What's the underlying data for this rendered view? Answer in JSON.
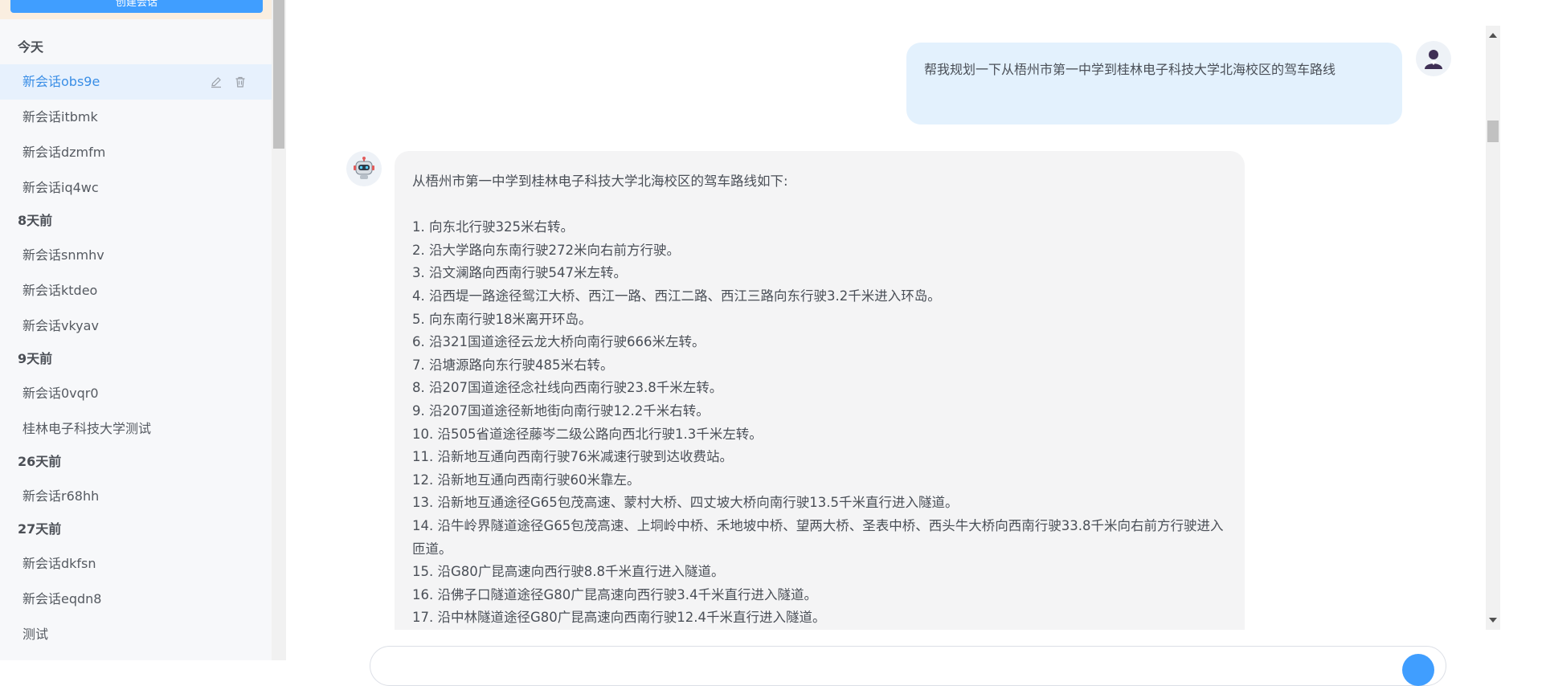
{
  "sidebar": {
    "new_chat_label": "创建会话",
    "groups": [
      {
        "label": "今天",
        "items": [
          "新会话obs9e",
          "新会话itbmk",
          "新会话dzmfm",
          "新会话iq4wc"
        ]
      },
      {
        "label": "8天前",
        "items": [
          "新会话snmhv",
          "新会话ktdeo",
          "新会话vkyav"
        ]
      },
      {
        "label": "9天前",
        "items": [
          "新会话0vqr0",
          "桂林电子科技大学测试"
        ]
      },
      {
        "label": "26天前",
        "items": [
          "新会话r68hh"
        ]
      },
      {
        "label": "27天前",
        "items": [
          "新会话dkfsn",
          "新会话eqdn8",
          "测试"
        ]
      }
    ],
    "active_item": "新会话obs9e"
  },
  "chat": {
    "user_message": "帮我规划一下从梧州市第一中学到桂林电子科技大学北海校区的驾车路线",
    "bot_intro": "从梧州市第一中学到桂林电子科技大学北海校区的驾车路线如下:",
    "steps": [
      "1. 向东北行驶325米右转。",
      "2. 沿大学路向东南行驶272米向右前方行驶。",
      "3. 沿文澜路向西南行驶547米左转。",
      "4. 沿西堤一路途径鸳江大桥、西江一路、西江二路、西江三路向东行驶3.2千米进入环岛。",
      "5. 向东南行驶18米离开环岛。",
      "6. 沿321国道途径云龙大桥向南行驶666米左转。",
      "7. 沿塘源路向东行驶485米右转。",
      "8. 沿207国道途径念社线向西南行驶23.8千米左转。",
      "9. 沿207国道途径新地街向南行驶12.2千米右转。",
      "10. 沿505省道途径藤岑二级公路向西北行驶1.3千米左转。",
      "11. 沿新地互通向西南行驶76米减速行驶到达收费站。",
      "12. 沿新地互通向西南行驶60米靠左。",
      "13. 沿新地互通途径G65包茂高速、蒙村大桥、四丈坡大桥向南行驶13.5千米直行进入隧道。",
      "14. 沿牛岭界隧道途径G65包茂高速、上垌岭中桥、禾地坡中桥、望两大桥、圣表中桥、西头牛大桥向西南行驶33.8千米向右前方行驶进入匝道。",
      "15. 沿G80广昆高速向西行驶8.8千米直行进入隧道。",
      "16. 沿佛子口隧道途径G80广昆高速向西行驶3.4千米直行进入隧道。",
      "17. 沿中林隧道途径G80广昆高速向西南行驶12.4千米直行进入隧道。"
    ]
  },
  "icons": {
    "edit": "edit-icon",
    "delete": "trash-icon",
    "user_avatar": "user-avatar-icon",
    "bot_avatar": "robot-avatar-icon"
  },
  "colors": {
    "accent": "#409eff",
    "active_bg": "#e7f1fd",
    "user_bubble": "#e3f1fd",
    "bot_bubble": "#f4f4f5"
  }
}
